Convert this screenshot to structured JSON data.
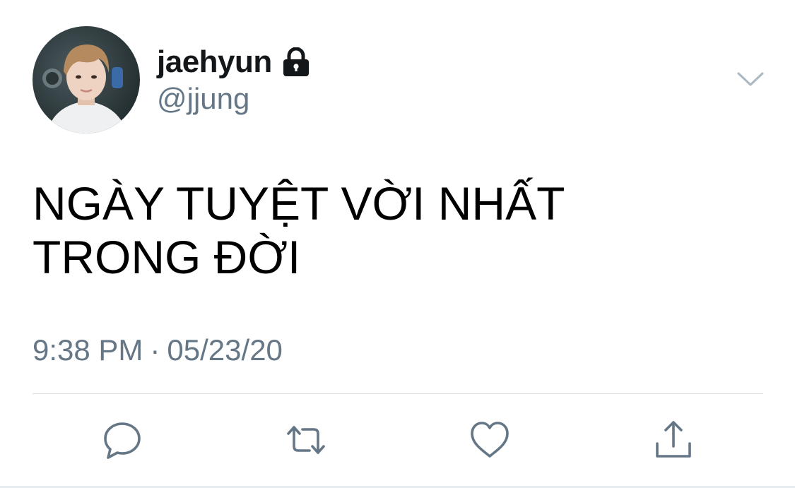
{
  "user": {
    "display_name": "jaehyun",
    "handle": "@jjung",
    "protected_icon": "lock-icon",
    "avatar": "profile-photo"
  },
  "tweet": {
    "text_line_1": "NGÀY TUYỆT VỜI NHẤT",
    "text_line_2": "TRONG ĐỜI",
    "time": "9:38 PM",
    "separator": "·",
    "date": "05/23/20"
  },
  "actions": [
    {
      "icon": "reply-icon"
    },
    {
      "icon": "retweet-icon"
    },
    {
      "icon": "like-icon"
    },
    {
      "icon": "share-icon"
    }
  ],
  "menu_icon": "chevron-down-icon",
  "colors": {
    "text_primary": "#14171a",
    "text_secondary": "#657786",
    "icon_gray": "#657786",
    "divider": "#d9dde0"
  }
}
